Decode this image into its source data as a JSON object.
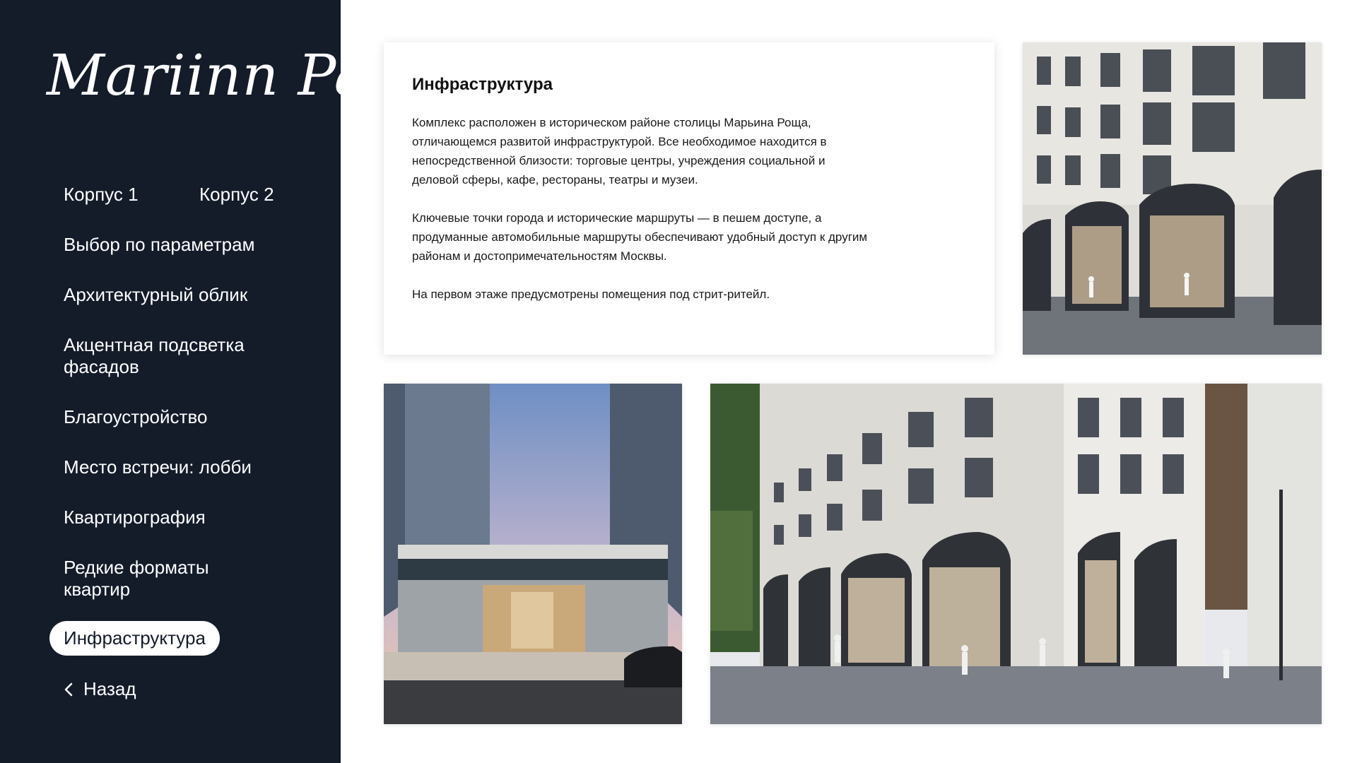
{
  "brand": {
    "logo_text": "Mariinn Park"
  },
  "nav": {
    "items": [
      {
        "label": "Корпус 1"
      },
      {
        "label": "Корпус 2"
      },
      {
        "label": "Выбор по параметрам"
      },
      {
        "label": "Архитектурный облик"
      },
      {
        "label": "Акцентная подсветка фасадов"
      },
      {
        "label": "Благоустройство"
      },
      {
        "label": "Место встречи: лобби"
      },
      {
        "label": "Квартирография"
      },
      {
        "label": "Редкие форматы квартир"
      },
      {
        "label": "Инфраструктура",
        "active": true
      }
    ],
    "back_label": "Назад"
  },
  "content": {
    "title": "Инфраструктура",
    "paragraphs": [
      "Комплекс расположен в историческом районе столицы Марьина Роща, отличающемся развитой инфраструктурой. Все необходимое находится в непосредственной близости: торговые центры, учреждения социальной и деловой сферы, кафе, рестораны, театры и музеи.",
      "Ключевые точки города и исторические маршруты — в пешем доступе, а продуманные автомобильные маршруты обеспечивают удобный доступ к другим районам и достопримечательностям Москвы.",
      "На первом этаже предусмотрены помещения под стрит-ритейл."
    ]
  },
  "colors": {
    "sidebar_bg": "#141c2a",
    "text_light": "#ffffff",
    "active_pill_bg": "#ffffff"
  }
}
